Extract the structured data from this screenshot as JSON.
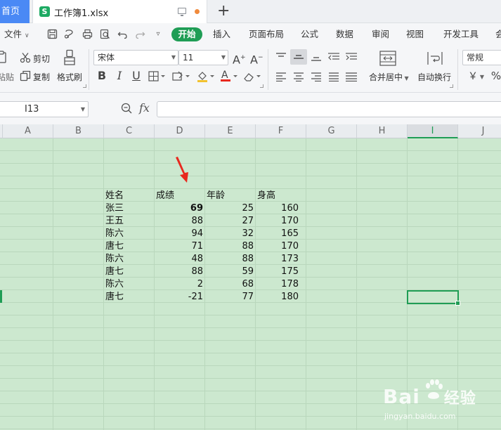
{
  "tabs": {
    "home_label": "首页",
    "file_label": "工作簿1.xlsx",
    "file_icon_letter": "S",
    "new_tab_symbol": "+"
  },
  "menu": {
    "file": "文件",
    "active": "开始",
    "items": [
      "插入",
      "页面布局",
      "公式",
      "数据",
      "审阅",
      "视图",
      "开发工具",
      "会"
    ]
  },
  "ribbon": {
    "paste": "粘贴",
    "cut": "剪切",
    "copy": "复制",
    "format_painter": "格式刷",
    "font_name": "宋体",
    "font_size": "11",
    "bold": "B",
    "italic": "I",
    "underline": "U",
    "merge": "合并居中",
    "wrap": "自动换行",
    "number_format": "常规",
    "currency": "￥",
    "percent": "%"
  },
  "formula_bar": {
    "cell_ref": "I13",
    "fx": "fx",
    "value": ""
  },
  "columns": [
    "A",
    "B",
    "C",
    "D",
    "E",
    "F",
    "G",
    "H",
    "I",
    "J"
  ],
  "selected_column": "I",
  "table": {
    "headers": [
      "姓名",
      "成绩",
      "年龄",
      "身高"
    ],
    "rows": [
      {
        "name": "张三",
        "score": "69",
        "age": "25",
        "height": "160"
      },
      {
        "name": "王五",
        "score": "88",
        "age": "27",
        "height": "170"
      },
      {
        "name": "陈六",
        "score": "94",
        "age": "32",
        "height": "165"
      },
      {
        "name": "唐七",
        "score": "71",
        "age": "88",
        "height": "170"
      },
      {
        "name": "陈六",
        "score": "48",
        "age": "88",
        "height": "173"
      },
      {
        "name": "唐七",
        "score": "88",
        "age": "59",
        "height": "175"
      },
      {
        "name": "陈六",
        "score": "2",
        "age": "68",
        "height": "178"
      },
      {
        "name": "唐七",
        "score": "-21",
        "age": "77",
        "height": "180"
      }
    ]
  },
  "colors": {
    "accent": "#1f9d55",
    "grid_bg": "#cce8cf",
    "home_tab": "#4a89f5",
    "arrow": "#e8281e"
  },
  "watermark": {
    "brand": "Bai",
    "brand_tail": "经验",
    "url": "jingyan.baidu.com"
  }
}
